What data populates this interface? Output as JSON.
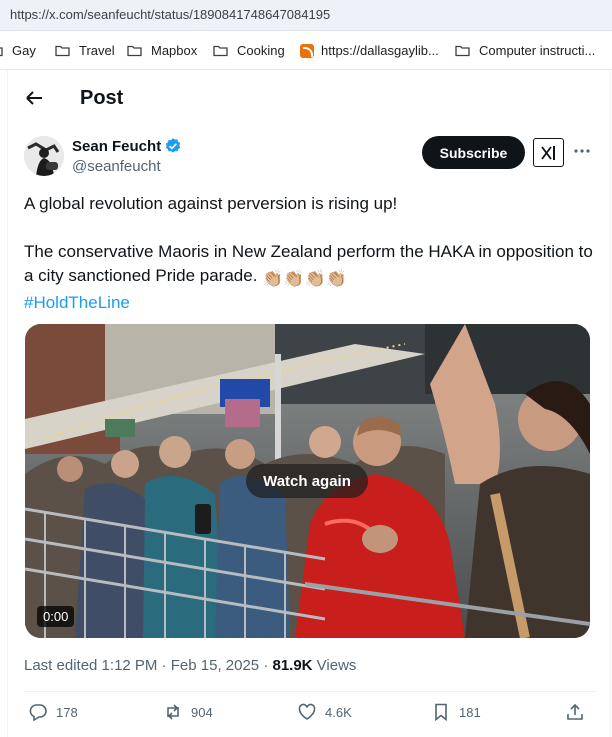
{
  "browser": {
    "url": "https://x.com/seanfeucht/status/1890841748647084195",
    "bookmarks": [
      {
        "label": "Gay",
        "icon": "folder-icon"
      },
      {
        "label": "Travel",
        "icon": "folder-icon"
      },
      {
        "label": "Mapbox",
        "icon": "folder-icon"
      },
      {
        "label": "Cooking",
        "icon": "folder-icon"
      },
      {
        "label": "https://dallasgaylib...",
        "icon": "rss-icon"
      },
      {
        "label": "Computer instructi...",
        "icon": "folder-icon"
      }
    ]
  },
  "header": {
    "title": "Post"
  },
  "author": {
    "name": "Sean Feucht",
    "handle": "@seanfeucht",
    "verified": true
  },
  "buttons": {
    "subscribe": "Subscribe"
  },
  "tweet": {
    "line1": "A global revolution against perversion is rising up!",
    "line2": "The conservative Maoris in New Zealand perform the HAKA in opposition to a city sanctioned Pride parade.",
    "emoji": "👏🏼👏🏼👏🏼👏🏼",
    "hashtag": "#HoldTheLine"
  },
  "video": {
    "overlay_label": "Watch again",
    "time": "0:00"
  },
  "meta": {
    "edited": "Last edited 1:12 PM · Feb 15, 2025 · ",
    "views_count": "81.9K",
    "views_label": " Views"
  },
  "actions": {
    "replies": "178",
    "reposts": "904",
    "likes": "4.6K",
    "bookmarks": "181"
  },
  "colors": {
    "accent": "#1d9bf0",
    "text": "#0f1419",
    "muted": "#536471",
    "verified": "#1d9bf0"
  }
}
